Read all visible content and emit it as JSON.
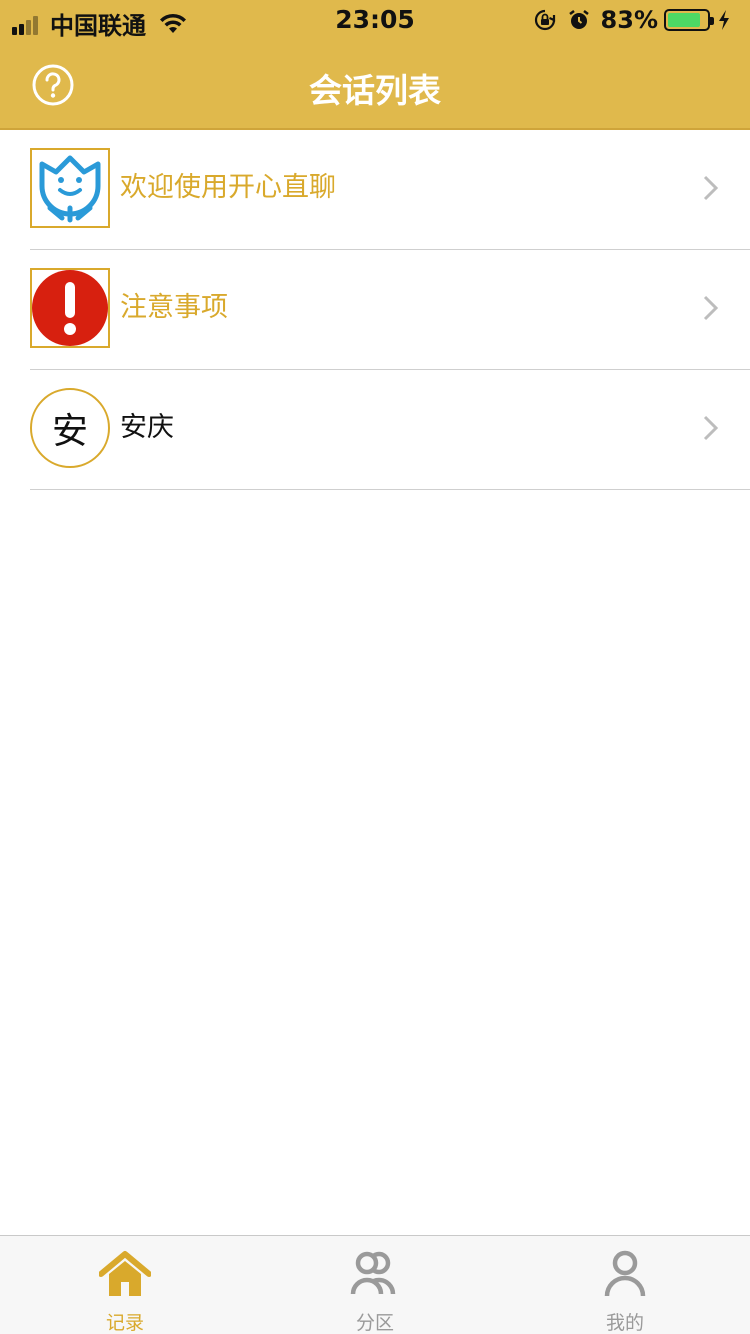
{
  "status_bar": {
    "carrier": "中国联通",
    "time": "23:05",
    "battery_percent": "83%",
    "battery_level": 0.83,
    "icons": [
      "signal-icon",
      "wifi-icon",
      "orientation-lock-icon",
      "alarm-icon",
      "battery-icon",
      "charging-icon"
    ]
  },
  "nav": {
    "title": "会话列表",
    "left_icon": "help-icon"
  },
  "conversations": [
    {
      "label": "欢迎使用开心直聊",
      "avatar": "smiley-flower-icon",
      "label_color": "#d9a92c"
    },
    {
      "label": "注意事项",
      "avatar": "exclamation-icon",
      "label_color": "#d9a92c"
    },
    {
      "label": "安庆",
      "avatar_text": "安",
      "label_color": "#111111"
    }
  ],
  "tabs": [
    {
      "label": "记录",
      "icon": "home-icon",
      "active": true
    },
    {
      "label": "分区",
      "icon": "group-icon",
      "active": false
    },
    {
      "label": "我的",
      "icon": "person-icon",
      "active": false
    }
  ],
  "colors": {
    "accent": "#e0b94c",
    "accent_text": "#d9a92c",
    "inactive": "#9a9a9a"
  }
}
